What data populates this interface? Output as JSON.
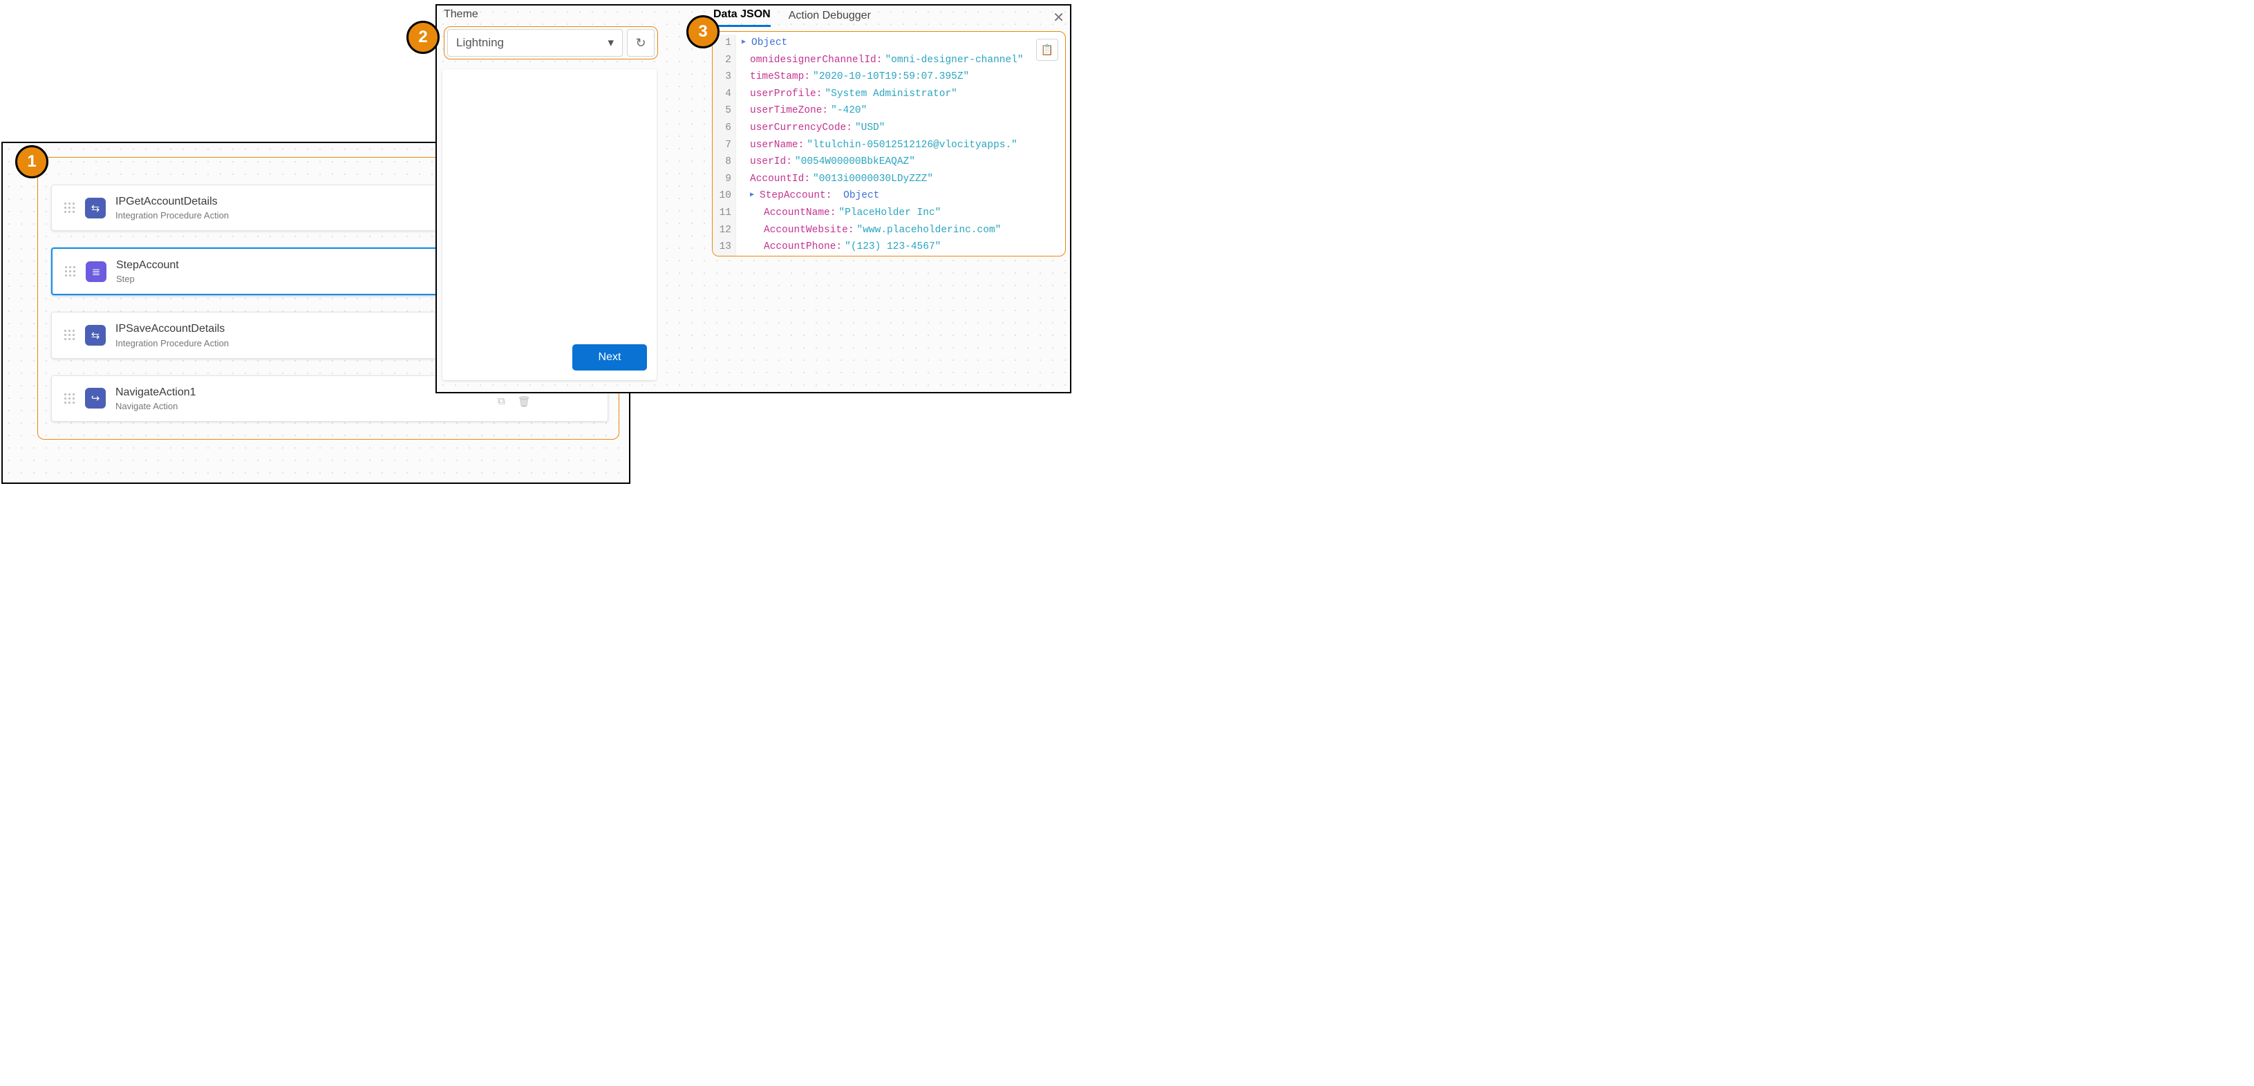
{
  "badges": {
    "one": "1",
    "two": "2",
    "three": "3"
  },
  "canvas": {
    "items": [
      {
        "title": "IPGetAccountDetails",
        "sub": "Integration Procedure Action",
        "iconClass": "ip",
        "selected": false
      },
      {
        "title": "StepAccount",
        "sub": "Step",
        "iconClass": "step",
        "selected": true
      },
      {
        "title": "IPSaveAccountDetails",
        "sub": "Integration Procedure Action",
        "iconClass": "ip",
        "selected": false
      },
      {
        "title": "NavigateAction1",
        "sub": "Navigate Action",
        "iconClass": "nav",
        "selected": false
      }
    ]
  },
  "theme": {
    "label": "Theme",
    "value": "Lightning"
  },
  "preview": {
    "nextLabel": "Next"
  },
  "jsonTabs": {
    "data": "Data JSON",
    "debugger": "Action Debugger"
  },
  "json": {
    "rootType": "Object",
    "omnidesignerChannelId": "\"omni-designer-channel\"",
    "timeStamp": "\"2020-10-10T19:59:07.395Z\"",
    "userProfile": "\"System Administrator\"",
    "userTimeZone": "\"-420\"",
    "userCurrencyCode": "\"USD\"",
    "userName": "\"ltulchin-05012512126@vlocityapps.\"",
    "userId": "\"0054W00000BbkEAQAZ\"",
    "AccountId": "\"0013i0000030LDyZZZ\"",
    "StepAccountType": "Object",
    "AccountName": "\"PlaceHolder Inc\"",
    "AccountWebsite": "\"www.placeholderinc.com\"",
    "AccountPhone": "\"(123) 123-4567\""
  },
  "jsonLabels": {
    "omnidesignerChannelId": "omnidesignerChannelId:",
    "timeStamp": "timeStamp:",
    "userProfile": "userProfile:",
    "userTimeZone": "userTimeZone:",
    "userCurrencyCode": "userCurrencyCode:",
    "userName": "userName:",
    "userId": "userId:",
    "AccountId": "AccountId:",
    "StepAccount": "StepAccount:",
    "AccountName": "AccountName:",
    "AccountWebsite": "AccountWebsite:",
    "AccountPhone": "AccountPhone:"
  },
  "lineNums": [
    "1",
    "2",
    "3",
    "4",
    "5",
    "6",
    "7",
    "8",
    "9",
    "10",
    "11",
    "12",
    "13"
  ]
}
